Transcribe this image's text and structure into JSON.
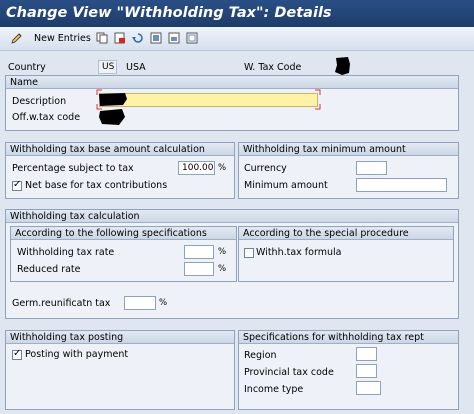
{
  "window": {
    "title": "Change View \"Withholding Tax\": Details"
  },
  "toolbar": {
    "new_entries": "New Entries"
  },
  "header": {
    "country_label": "Country",
    "country_code": "US",
    "country_name": "USA",
    "wtax_code_label": "W. Tax Code"
  },
  "name_group": {
    "title": "Name",
    "description_label": "Description",
    "offw_label": "Off.w.tax code"
  },
  "base_group": {
    "title": "Withholding tax base amount calculation",
    "percentage_label": "Percentage subject to tax",
    "percentage_value": "100.00",
    "percent_sign": "%",
    "net_base_label": "Net base for tax contributions",
    "net_base_checked": true
  },
  "min_group": {
    "title": "Withholding tax minimum amount",
    "currency_label": "Currency",
    "minimum_label": "Minimum amount"
  },
  "calc_group": {
    "title": "Withholding tax calculation",
    "spec_title": "According to the following specifications",
    "rate_label": "Withholding tax rate",
    "reduced_label": "Reduced rate",
    "proc_title": "According to the special procedure",
    "formula_label": "Withh.tax formula",
    "formula_checked": false,
    "germ_label": "Germ.reunificatn tax",
    "percent_sign": "%"
  },
  "posting_group": {
    "title": "Withholding tax posting",
    "posting_label": "Posting with payment",
    "posting_checked": true
  },
  "report_group": {
    "title": "Specifications for withholding tax rept",
    "region_label": "Region",
    "provincial_label": "Provincial tax code",
    "income_label": "Income type"
  },
  "icons": [
    "pencil-icon",
    "copy-icon",
    "delete-icon",
    "undo-icon",
    "select-all-icon",
    "select-block-icon",
    "deselect-icon"
  ],
  "colors": {
    "title_bar": "#1d3c6b",
    "required_field": "#fdf2a6"
  }
}
